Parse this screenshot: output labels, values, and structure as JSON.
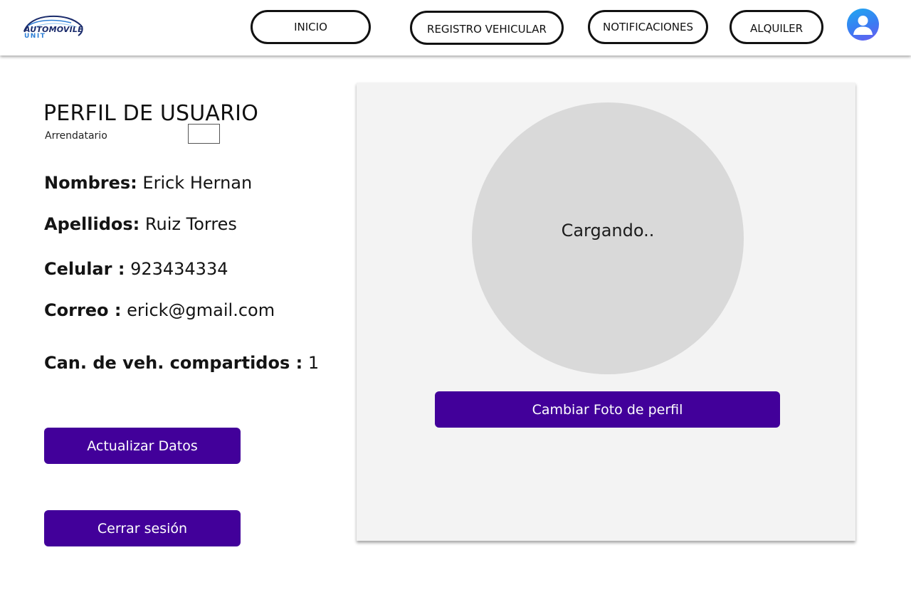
{
  "header": {
    "logo": {
      "line1": "AUTOMOVILE",
      "line2": "UNIT"
    },
    "nav": [
      {
        "label": "INICIO"
      },
      {
        "label": "REGISTRO VEHICULAR"
      },
      {
        "label": "NOTIFICACIONES"
      },
      {
        "label": "ALQUILER"
      }
    ],
    "avatar_icon": "user-avatar-icon"
  },
  "profile": {
    "title": "PERFIL DE USUARIO",
    "role": "Arrendatario",
    "fields": {
      "nombres": {
        "label": "Nombres:",
        "value": "Erick Hernan"
      },
      "apellidos": {
        "label": "Apellidos:",
        "value": "Ruiz Torres"
      },
      "celular": {
        "label": "Celular :",
        "value": "923434334"
      },
      "correo": {
        "label": "Correo :",
        "value": "erick@gmail.com"
      },
      "vehiculos": {
        "label": "Can. de veh. compartidos :",
        "value": "1"
      }
    },
    "buttons": {
      "update": "Actualizar Datos",
      "logout": "Cerrar sesión"
    }
  },
  "photo_panel": {
    "loading_text": "Cargando..",
    "change_photo": "Cambiar Foto de perfil"
  },
  "colors": {
    "primary": "#42009a",
    "panel_bg": "#f3f3f3",
    "photo_placeholder": "#d9d9d9",
    "avatar_gradient_start": "#1fa9f0",
    "avatar_gradient_end": "#6a5cf0"
  }
}
